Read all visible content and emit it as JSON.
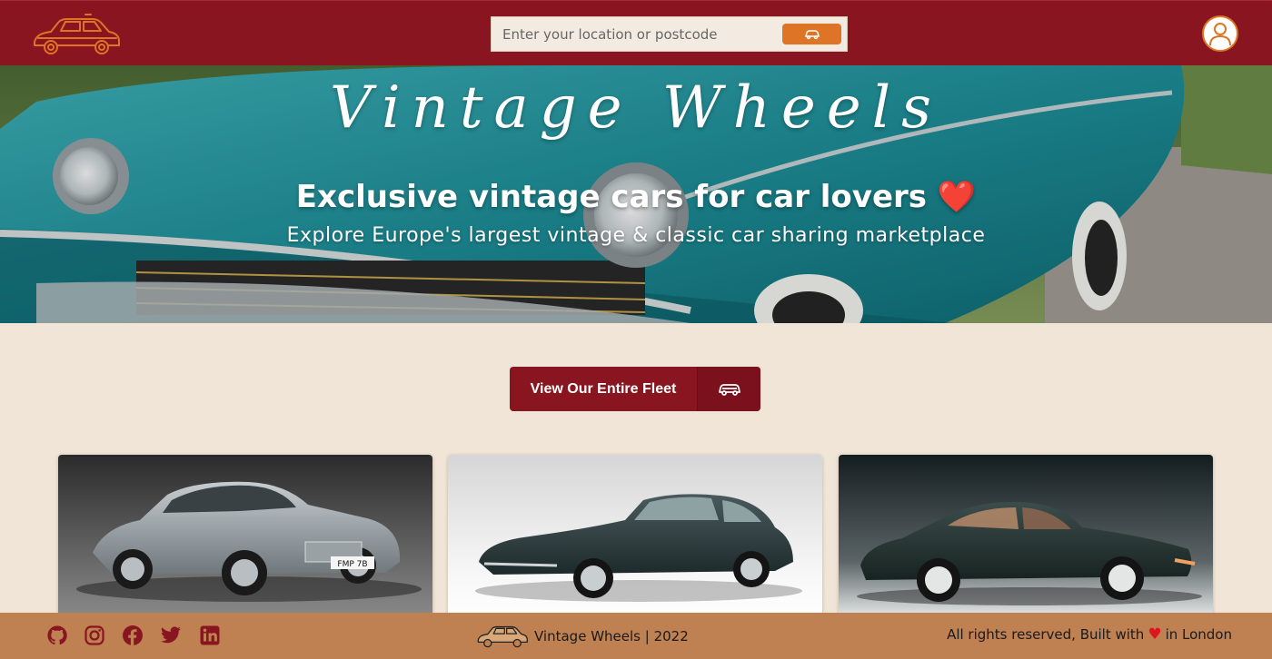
{
  "header": {
    "logo_icon": "vintage-car-logo-icon",
    "search": {
      "placeholder": "Enter your location or postcode",
      "value": "",
      "button_icon": "car-icon"
    },
    "account_icon": "user-icon"
  },
  "hero": {
    "title": "Vintage Wheels",
    "subtitle": "Exclusive vintage cars for car lovers",
    "subtitle_emoji": "❤️",
    "tagline": "Explore Europe's largest vintage & classic car sharing marketplace"
  },
  "fleet_button": {
    "label": "View Our Entire Fleet",
    "icon": "car-icon"
  },
  "cars": [
    {
      "name": "silver-classic-coupe",
      "plate": "FMP 7B"
    },
    {
      "name": "dark-green-sports-coupe"
    },
    {
      "name": "dark-green-rear-engine-coupe"
    }
  ],
  "footer": {
    "social": [
      "github-icon",
      "instagram-icon",
      "facebook-icon",
      "twitter-icon",
      "linkedin-icon"
    ],
    "brand": "Vintage Wheels | 2022",
    "rights_prefix": "All rights reserved, Built with",
    "rights_heart": "♥",
    "rights_suffix": "in London"
  },
  "colors": {
    "primary": "#891521",
    "accent": "#de7526",
    "background": "#f0e5d6",
    "footer": "#bf8052"
  }
}
